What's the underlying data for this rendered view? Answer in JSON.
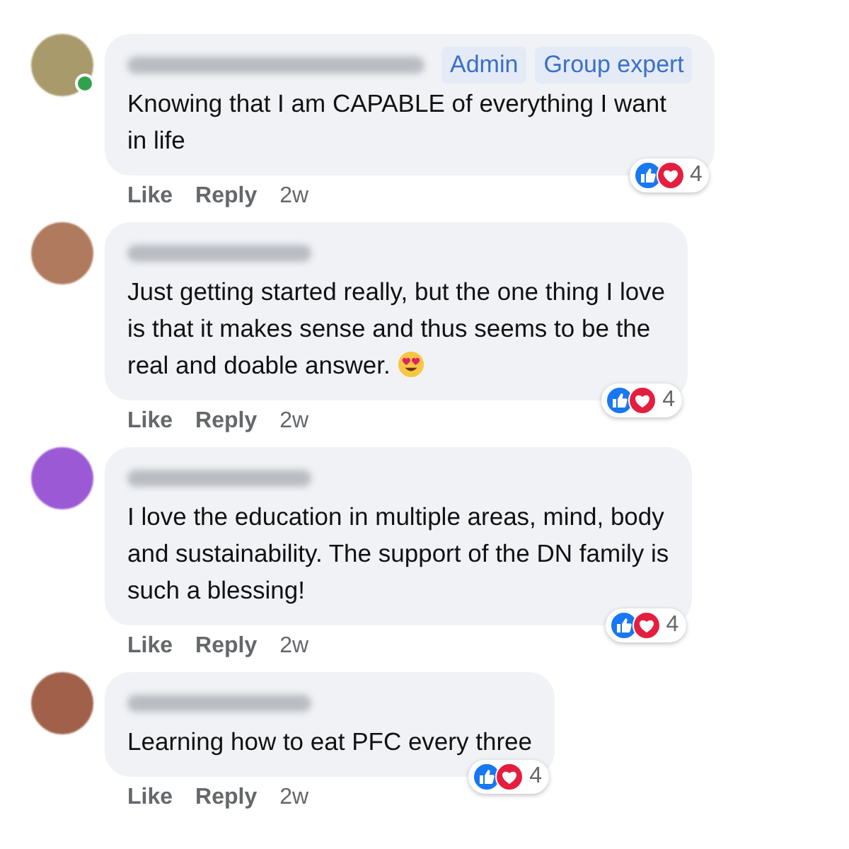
{
  "comments": [
    {
      "online": true,
      "badges": [
        "Admin",
        "Group expert"
      ],
      "lines": [
        "Knowing that I am CAPABLE of everything I want",
        "in life"
      ],
      "actions": [
        "Like",
        "Reply"
      ],
      "time": "2w",
      "reactions": "4"
    },
    {
      "lines": [
        "Just getting started really, but the one thing I love",
        "is that it makes sense and thus seems to be the",
        "real and doable answer."
      ],
      "emoji": true,
      "actions": [
        "Like",
        "Reply"
      ],
      "time": "2w",
      "reactions": "4"
    },
    {
      "lines": [
        "I love the education in multiple areas, mind, body",
        "and sustainability. The support of the DN family is",
        "such a blessing!"
      ],
      "actions": [
        "Like",
        "Reply"
      ],
      "time": "2w",
      "reactions": "4"
    },
    {
      "lines": [
        "Learning how to eat PFC every three"
      ],
      "actions": [
        "Like",
        "Reply"
      ],
      "time": "2w",
      "reactions": "4"
    }
  ]
}
